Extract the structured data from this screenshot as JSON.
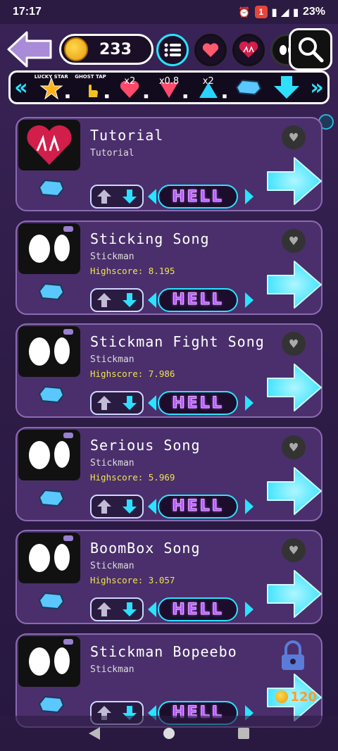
{
  "status": {
    "time": "17:17",
    "notifications": "1",
    "battery": "23%"
  },
  "topbar": {
    "coins": "233"
  },
  "modifiers": [
    {
      "label": "LUCKY STAR",
      "value": ""
    },
    {
      "label": "GHOST TAP",
      "value": ""
    },
    {
      "label": "",
      "value": "x2"
    },
    {
      "label": "",
      "value": "x0.8"
    },
    {
      "label": "",
      "value": "x2"
    },
    {
      "label": "",
      "value": ""
    }
  ],
  "songs": [
    {
      "title": "Tutorial",
      "artist": "Tutorial",
      "score": "",
      "difficulty": "HELL",
      "locked": false,
      "price": ""
    },
    {
      "title": "Sticking Song",
      "artist": "Stickman",
      "score": "Highscore: 8.195",
      "difficulty": "HELL",
      "locked": false,
      "price": ""
    },
    {
      "title": "Stickman Fight Song",
      "artist": "Stickman",
      "score": "Highscore: 7.986",
      "difficulty": "HELL",
      "locked": false,
      "price": ""
    },
    {
      "title": "Serious Song",
      "artist": "Stickman",
      "score": "Highscore: 5.969",
      "difficulty": "HELL",
      "locked": false,
      "price": ""
    },
    {
      "title": "BoomBox Song",
      "artist": "Stickman",
      "score": "Highscore: 3.057",
      "difficulty": "HELL",
      "locked": false,
      "price": ""
    },
    {
      "title": "Stickman Bopeebo",
      "artist": "Stickman",
      "score": "",
      "difficulty": "HELL",
      "locked": true,
      "price": "120"
    }
  ],
  "colors": {
    "accent": "#28e4ff",
    "difficulty": "#b55bff",
    "highscore": "#f1e34a"
  }
}
